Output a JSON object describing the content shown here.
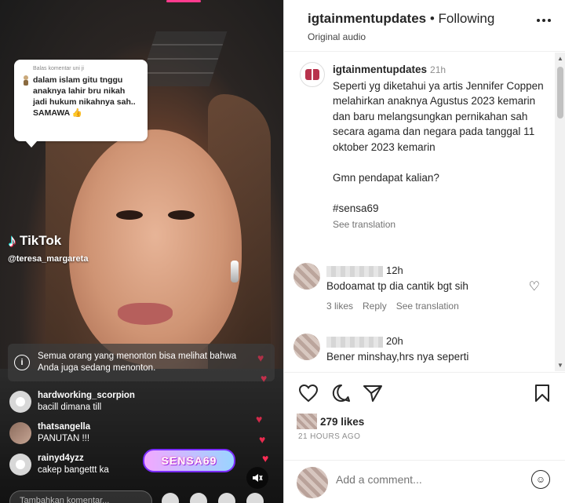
{
  "video": {
    "reply_card": {
      "header": "Balas komentar uni ji",
      "text": "dalam islam gitu tnggu anaknya lahir bru nikah jadi hukum nikahnya sah.. SAMAWA 👍"
    },
    "watermark_brand": "TikTok",
    "watermark_user": "@teresa_margareta",
    "notice_text": "Semua orang yang menonton bisa melihat bahwa Anda juga sedang menonton.",
    "notice_icon": "info-icon",
    "live_comments": [
      {
        "user": "hardworking_scorpion",
        "text": "bacill dimana till"
      },
      {
        "user": "thatsangella",
        "text": "PANUTAN !!!"
      },
      {
        "user": "rainyd4yzz",
        "text": "cakep bangettt ka"
      }
    ],
    "sticker_text": "SENSA69",
    "comment_placeholder": "Tambahkan komentar...",
    "colors": {
      "heart": "#ff2d55",
      "tiktok_cyan": "#25f4ee",
      "tiktok_red": "#fe2c55"
    }
  },
  "panel": {
    "header": {
      "username": "igtainmentupdates",
      "separator": " • ",
      "follow_status": "Following",
      "audio": "Original audio"
    },
    "post": {
      "username": "igtainmentupdates",
      "time": "21h",
      "caption": "Seperti yg diketahui ya artis Jennifer Coppen melahirkan anaknya Agustus 2023 kemarin dan baru melangsungkan pernikahan sah secara agama dan negara pada tanggal 11 oktober 2023 kemarin\n\nGmn pendapat kalian?\n\n#sensa69",
      "see_translation": "See translation"
    },
    "comments": [
      {
        "time": "12h",
        "text": "Bodoamat tp dia cantik bgt sih",
        "likes": "3 likes",
        "reply": "Reply",
        "see_translation": "See translation"
      },
      {
        "time": "20h",
        "text": "Bener minshay,hrs nya seperti"
      }
    ],
    "likes_count": "279 likes",
    "time_ago": "21 HOURS AGO",
    "add_comment_placeholder": "Add a comment..."
  }
}
